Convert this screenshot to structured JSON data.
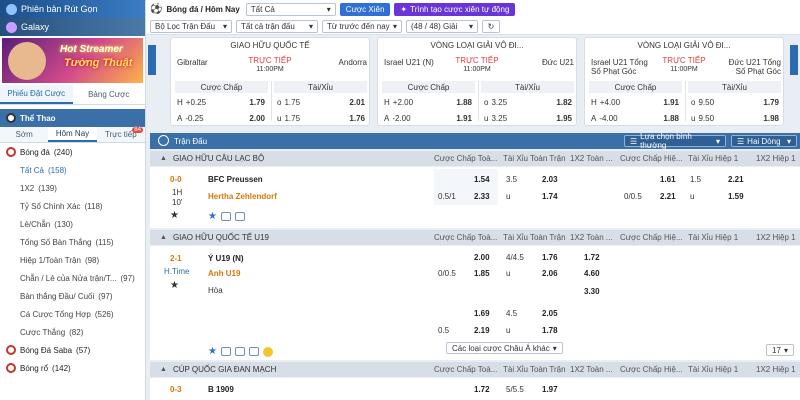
{
  "sidebar": {
    "promo_top": "Phiên bản Rút Gọn",
    "promo_galaxy": "Galaxy",
    "banner_line1": "Hot Streamer",
    "banner_line2": "Tường Thuật",
    "tabs": [
      "Phiếu Đặt Cược",
      "Bảng Cược"
    ],
    "sport_header": "Thể Thao",
    "subtabs": [
      "Sớm",
      "Hôm Nay",
      "Trực tiếp"
    ],
    "live_badge": "84",
    "items": [
      {
        "label": "Bóng đá",
        "count": "(240)",
        "type": "cat"
      },
      {
        "label": "Tất Cả",
        "count": "(158)",
        "type": "sel"
      },
      {
        "label": "1X2",
        "count": "(139)",
        "type": "sub"
      },
      {
        "label": "Tỷ Số Chính Xác",
        "count": "(118)",
        "type": "sub"
      },
      {
        "label": "Lẻ/Chẵn",
        "count": "(130)",
        "type": "sub"
      },
      {
        "label": "Tổng Số Bàn Thắng",
        "count": "(115)",
        "type": "sub"
      },
      {
        "label": "Hiệp 1/Toàn Trận",
        "count": "(98)",
        "type": "sub"
      },
      {
        "label": "Chẵn / Lẻ của Nửa trận/T...",
        "count": "(97)",
        "type": "sub"
      },
      {
        "label": "Bàn thắng Đầu/ Cuối",
        "count": "(97)",
        "type": "sub"
      },
      {
        "label": "Cá Cược Tổng Hợp",
        "count": "(526)",
        "type": "sub"
      },
      {
        "label": "Cược Thắng",
        "count": "(82)",
        "type": "sub"
      },
      {
        "label": "Bóng Đá Saba",
        "count": "(57)",
        "type": "cat"
      },
      {
        "label": "Bóng rổ",
        "count": "(142)",
        "type": "cat"
      }
    ]
  },
  "topbar": {
    "breadcrumb": "Bóng đá / Hôm Nay",
    "select_all": "Tất Cả",
    "parlay_button": "Cược Xiên",
    "auto_parlay_button": "Trình tạo cược xiên tự động",
    "filter_league": "Bộ Lọc Trận Đấu",
    "filter_period": "Tất cả trận đấu",
    "filter_sort": "Từ trước đến nay",
    "count": "(48 / 48) Giải"
  },
  "cards": [
    {
      "league": "GIAO HỮU QUỐC TẾ",
      "home": "Gibraltar",
      "away": "Andorra",
      "status": "TRỰC TIẾP",
      "time": "11:00PM",
      "h1": "Cược Chấp",
      "h2": "Tài/Xỉu",
      "rows": [
        [
          "H",
          "+0.25",
          "1.79",
          "o",
          "1.75",
          "2.01"
        ],
        [
          "A",
          "-0.25",
          "2.00",
          "u",
          "1.75",
          "1.76"
        ]
      ]
    },
    {
      "league": "VÒNG LOẠI GIẢI VÔ ĐI...",
      "home": "Israel U21 (N)",
      "away": "Đức U21",
      "status": "TRỰC TIẾP",
      "time": "11:00PM",
      "h1": "Cược Chấp",
      "h2": "Tài/Xỉu",
      "rows": [
        [
          "H",
          "+2.00",
          "1.88",
          "o",
          "3.25",
          "1.82"
        ],
        [
          "A",
          "-2.00",
          "1.91",
          "u",
          "3.25",
          "1.95"
        ]
      ]
    },
    {
      "league": "VÒNG LOẠI GIẢI VÔ ĐI...",
      "home": "Israel U21 Tổng Số Phạt Góc",
      "away": "Đức U21 Tổng Số Phạt Góc",
      "status": "TRỰC TIẾP",
      "time": "11:00PM",
      "h1": "Cược Chấp",
      "h2": "Tài/Xỉu",
      "rows": [
        [
          "H",
          "+4.00",
          "1.91",
          "o",
          "9.50",
          "1.79"
        ],
        [
          "A",
          "-4.00",
          "1.88",
          "u",
          "9.50",
          "1.98"
        ]
      ]
    }
  ],
  "table": {
    "title": "Trận Đấu",
    "odds_type": "Lựa chọn bình thường",
    "lines": "Hai Dòng",
    "col_headers": [
      "Cược Chấp Toà...",
      "Tài Xỉu Toàn Trận",
      "1X2 Toàn ...",
      "Cược Chấp Hiệ...",
      "Tài Xỉu Hiệp 1",
      "1X2 Hiệp 1"
    ],
    "groups": [
      {
        "league": "GIAO HỮU CÂU LẠC BỘ"
      },
      {
        "league": "GIAO HỮU QUỐC TẾ U19"
      },
      {
        "league": "CÚP QUỐC GIA ĐAN MẠCH"
      }
    ],
    "match1": {
      "score": "0-0",
      "period": "1H",
      "minute": "10'",
      "home": "BFC Preussen",
      "away": "Hertha Zehlendorf",
      "ft_hdp_home": "",
      "ft_hdp_home_odd": "1.54",
      "ft_ou_line": "3.5",
      "ft_ou_odd": "2.03",
      "ft_hdp_away": "0.5/1",
      "ft_hdp_away_odd": "2.33",
      "ft_ou_u": "u",
      "ft_ou_u_odd": "1.74",
      "h1_hdp_home_odd": "1.61",
      "h1_ou_line": "1.5",
      "h1_ou_odd": "2.21",
      "h1_hdp_away": "0/0.5",
      "h1_hdp_away_odd": "2.21",
      "h1_ou_u": "u",
      "h1_ou_u_odd": "1.59"
    },
    "match2": {
      "score": "2-1",
      "period": "H.Time",
      "home": "Ý U19 (N)",
      "away": "Anh U19",
      "draw": "Hòa",
      "r1": [
        "",
        "2.00",
        "4/4.5",
        "1.76",
        "1.72"
      ],
      "r2": [
        "0/0.5",
        "1.85",
        "u",
        "2.06",
        "4.60"
      ],
      "r3": [
        "",
        "",
        "",
        "",
        "3.30"
      ],
      "r4": [
        "",
        "1.69",
        "4.5",
        "2.05",
        ""
      ],
      "r5": [
        "0.5",
        "2.19",
        "u",
        "1.78",
        ""
      ],
      "more_markets": "Các loại cược Châu Á khác",
      "more_count": "17"
    },
    "match3": {
      "score": "0-3",
      "home": "B 1909",
      "ft_hdp_odd": "1.72",
      "ft_ou_line": "5/5.5",
      "ft_ou_odd": "1.97"
    }
  },
  "colors": {
    "accent": "#2f6fd6",
    "purple": "#6a35d8",
    "header": "#3a6fa8",
    "live": "#e23b3b",
    "away": "#d9770a"
  }
}
